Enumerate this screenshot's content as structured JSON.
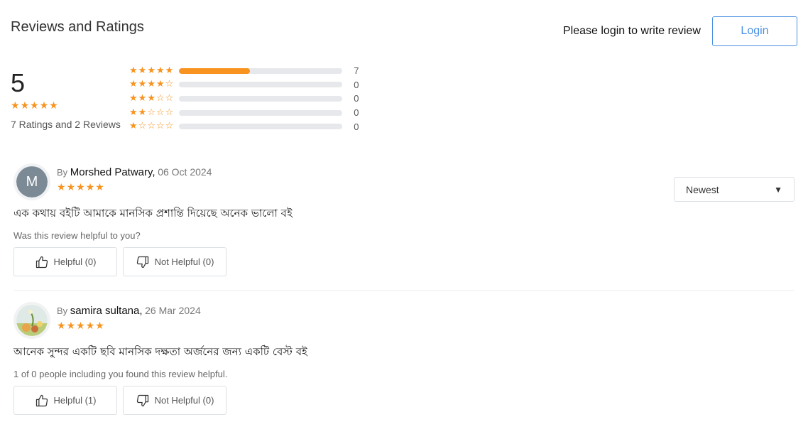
{
  "header": {
    "title": "Reviews and Ratings",
    "login_prompt": "Please login to write review",
    "login_button": "Login"
  },
  "summary": {
    "average": "5",
    "average_stars": 5,
    "summary_text": "7 Ratings and 2 Reviews"
  },
  "distribution": [
    {
      "stars": 5,
      "count": "7",
      "fraction": 0.435
    },
    {
      "stars": 4,
      "count": "0",
      "fraction": 0
    },
    {
      "stars": 3,
      "count": "0",
      "fraction": 0
    },
    {
      "stars": 2,
      "count": "0",
      "fraction": 0
    },
    {
      "stars": 1,
      "count": "0",
      "fraction": 0
    }
  ],
  "sort": {
    "selected": "Newest"
  },
  "reviews": [
    {
      "by": "By",
      "name": "Morshed Patwary,",
      "date": "06 Oct 2024",
      "avatar_letter": "M",
      "rating": 5,
      "text": "এক কথায় বইটি আমাকে মানসিক প্রশান্তি দিয়েছে অনেক ভালো বই",
      "helpful_text": "Was this review helpful to you?",
      "helpful_label": "Helpful (0)",
      "not_helpful_label": "Not Helpful (0)"
    },
    {
      "by": "By",
      "name": "samira sultana,",
      "date": "26 Mar 2024",
      "avatar_letter": "",
      "rating": 5,
      "text": "আনেক সুন্দর একটি ছবি মানসিক দক্ষতা অর্জনের জন্য একটি বেস্ট বই",
      "helpful_text": "1 of 0 people including you found this review helpful.",
      "helpful_label": "Helpful (1)",
      "not_helpful_label": "Not Helpful (0)"
    }
  ],
  "colors": {
    "star": "#f7931e",
    "accent": "#4a90e2",
    "bar_track": "#e6e8eb"
  }
}
